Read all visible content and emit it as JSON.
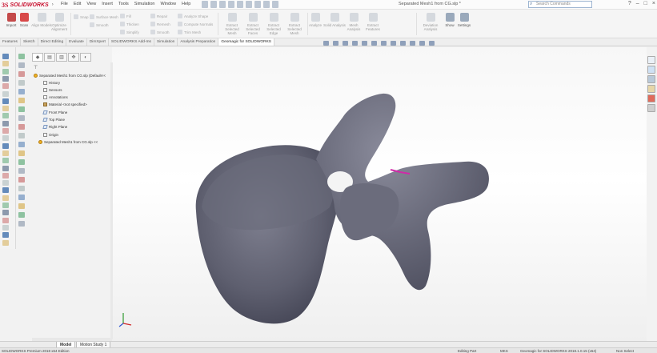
{
  "app": {
    "logo_text": "SOLIDWORKS",
    "logo_mark": "3S"
  },
  "menu": [
    "File",
    "Edit",
    "View",
    "Insert",
    "Tools",
    "Simulation",
    "Window",
    "Help"
  ],
  "document_title": "Separated Mesh1 from CG.slp *",
  "search_placeholder": "Search Commands",
  "window_controls": [
    "?",
    "–",
    "□",
    "×"
  ],
  "ribbon": {
    "left_buttons": [
      {
        "label": "Import",
        "active": true
      },
      {
        "label": "Scan",
        "active": true
      },
      {
        "label": "Align Models",
        "active": false
      },
      {
        "label": "Optimize Alignment",
        "active": false
      }
    ],
    "small_tools": [
      [
        "Snap",
        "Surface Mesh",
        "Smooth"
      ],
      [
        "Fill",
        "Thicken",
        "Simplify"
      ],
      [
        "Repair",
        "Remesh",
        "Smooth"
      ],
      [
        "Analyze Shape",
        "Compute Normals",
        "Trim Mesh"
      ]
    ],
    "feature_buttons": [
      "Extract Selected Mesh",
      "Extract Selected Faces",
      "Extract Selected Edge",
      "Extract Selected Mesh"
    ],
    "mesh_buttons": [
      "Analyze",
      "Solid Analysis",
      "Mesh Analysis",
      "Extract Features"
    ],
    "right_buttons": [
      {
        "label": "Deviation Analysis"
      },
      {
        "label": "Show"
      },
      {
        "label": "Settings"
      }
    ]
  },
  "tabs": [
    {
      "label": "Features",
      "active": false
    },
    {
      "label": "Sketch",
      "active": false
    },
    {
      "label": "Direct Editing",
      "active": false
    },
    {
      "label": "Evaluate",
      "active": false
    },
    {
      "label": "DimXpert",
      "active": false
    },
    {
      "label": "SOLIDWORKS Add-Ins",
      "active": false
    },
    {
      "label": "Simulation",
      "active": false
    },
    {
      "label": "Analysis Preparation",
      "active": false
    },
    {
      "label": "Geomagic for SOLIDWORKS",
      "active": true
    }
  ],
  "tree": {
    "root": "Separated Mesh1 from CG.slp (Default<<",
    "items": [
      {
        "label": "History",
        "icon": "history"
      },
      {
        "label": "Sensors",
        "icon": "sensor"
      },
      {
        "label": "Annotations",
        "icon": "annotation"
      },
      {
        "label": "Material <not specified>",
        "icon": "material"
      },
      {
        "label": "Front Plane",
        "icon": "plane"
      },
      {
        "label": "Top Plane",
        "icon": "plane"
      },
      {
        "label": "Right Plane",
        "icon": "plane"
      },
      {
        "label": "Origin",
        "icon": "origin"
      },
      {
        "label": "Separated Mesh1 from CG.slp <<",
        "icon": "mesh"
      }
    ]
  },
  "bottom_tabs": [
    {
      "label": "Model",
      "active": true
    },
    {
      "label": "Motion Study 1",
      "active": false
    }
  ],
  "status": {
    "left": "SOLIDWORKS Premium 2018 x64 Edition",
    "editing": "Editing Part",
    "units": "MKS",
    "product": "Geomagic for SOLIDWORKS 2018.1.0.15 (x64)",
    "select": "Non Select"
  },
  "colors": {
    "brand": "#c8102e",
    "mesh": "#5b5c6d",
    "highlight": "#d02aa8"
  }
}
